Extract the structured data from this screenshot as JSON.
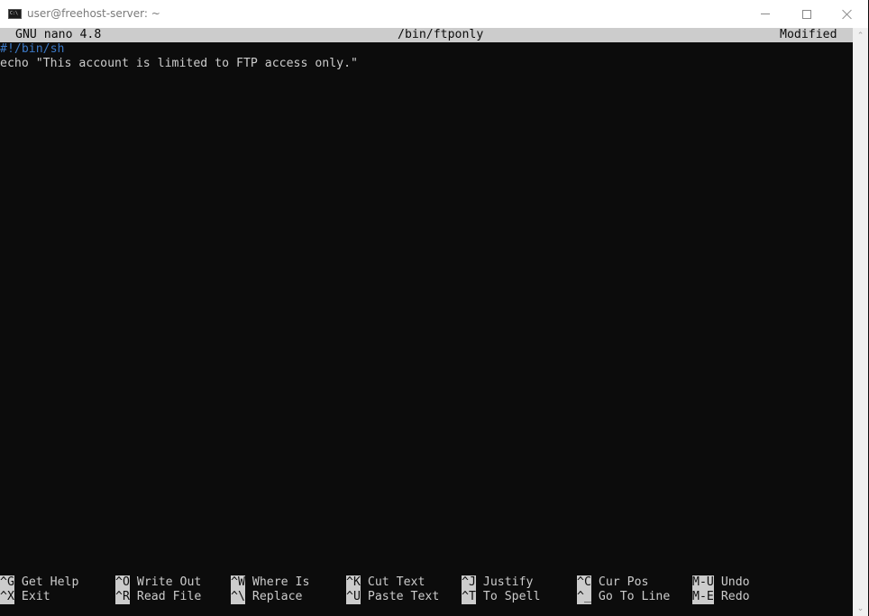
{
  "window": {
    "title": "user@freehost-server: ~",
    "icon": "console-icon",
    "controls": {
      "minimize": "minimize-icon",
      "maximize": "maximize-icon",
      "close": "close-icon"
    }
  },
  "nano": {
    "header": {
      "version": "GNU nano 4.8",
      "filename": "/bin/ftponly",
      "status": "Modified"
    },
    "lines": [
      "#!/bin/sh",
      "echo \"This account is limited to FTP access only.\""
    ],
    "shortcuts": [
      {
        "key": "^G",
        "label": "Get Help"
      },
      {
        "key": "^O",
        "label": "Write Out"
      },
      {
        "key": "^W",
        "label": "Where Is"
      },
      {
        "key": "^K",
        "label": "Cut Text"
      },
      {
        "key": "^J",
        "label": "Justify"
      },
      {
        "key": "^C",
        "label": "Cur Pos"
      },
      {
        "key": "M-U",
        "label": "Undo"
      },
      {
        "key": "^X",
        "label": "Exit"
      },
      {
        "key": "^R",
        "label": "Read File"
      },
      {
        "key": "^\\",
        "label": "Replace"
      },
      {
        "key": "^U",
        "label": "Paste Text"
      },
      {
        "key": "^T",
        "label": "To Spell"
      },
      {
        "key": "^_",
        "label": "Go To Line"
      },
      {
        "key": "M-E",
        "label": "Redo"
      }
    ]
  },
  "scrollbar": {
    "up": "scroll-up-arrow-icon",
    "down": "scroll-down-arrow-icon",
    "glyph_up": "⌃",
    "glyph_down": "⌄"
  }
}
